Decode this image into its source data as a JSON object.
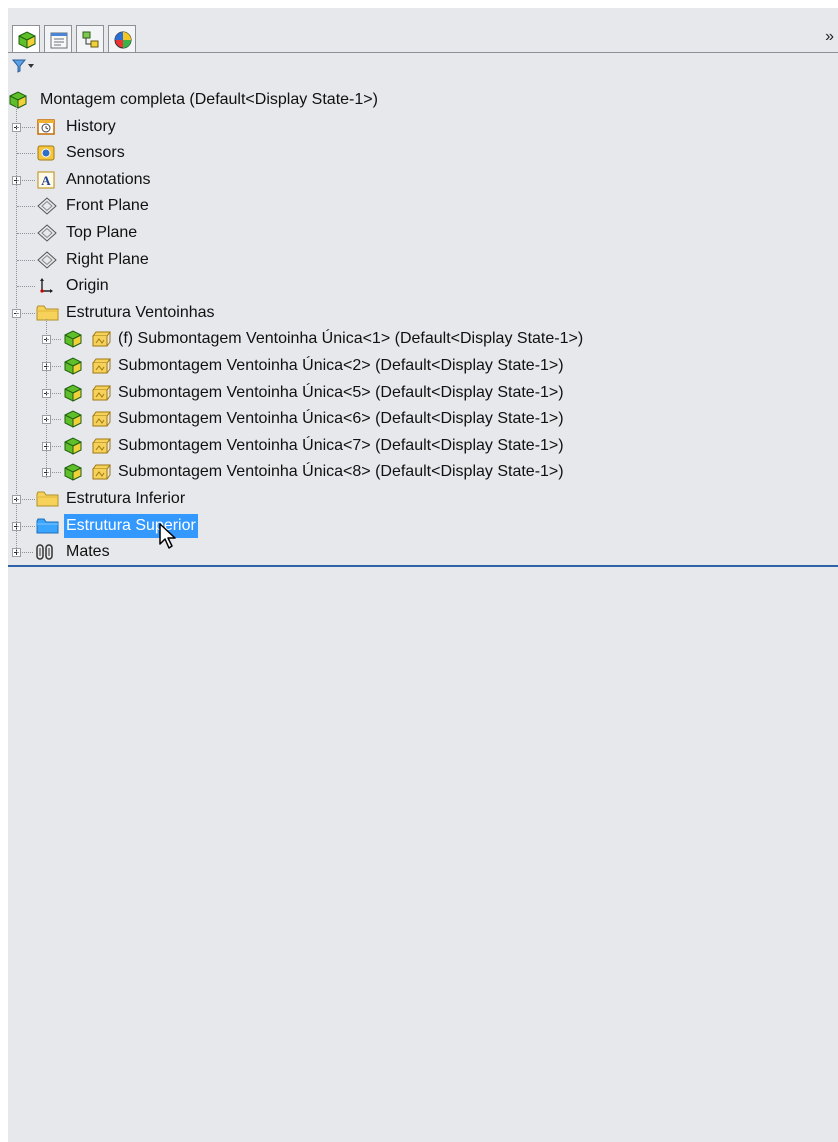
{
  "panel": {
    "tabs": [
      {
        "icon": "feature-manager-icon",
        "active": true
      },
      {
        "icon": "property-manager-icon",
        "active": false
      },
      {
        "icon": "configuration-manager-icon",
        "active": false
      },
      {
        "icon": "display-manager-icon",
        "active": false
      }
    ],
    "more_label": "»",
    "filter_icon": "filter-icon"
  },
  "tree": {
    "root": "Montagem completa  (Default<Display State-1>)",
    "items": [
      {
        "label": "History",
        "icon": "history-icon"
      },
      {
        "label": "Sensors",
        "icon": "sensors-icon"
      },
      {
        "label": "Annotations",
        "icon": "annotations-icon"
      },
      {
        "label": "Front Plane",
        "icon": "plane-icon"
      },
      {
        "label": "Top Plane",
        "icon": "plane-icon"
      },
      {
        "label": "Right Plane",
        "icon": "plane-icon"
      },
      {
        "label": "Origin",
        "icon": "origin-icon"
      },
      {
        "label": "Estrutura Ventoinhas",
        "icon": "folder-icon"
      }
    ],
    "subassemblies": [
      {
        "label": "(f) Submontagem Ventoinha Única<1> (Default<Display State-1>)"
      },
      {
        "label": "Submontagem Ventoinha Única<2> (Default<Display State-1>)"
      },
      {
        "label": "Submontagem Ventoinha Única<5> (Default<Display State-1>)"
      },
      {
        "label": "Submontagem Ventoinha Única<6> (Default<Display State-1>)"
      },
      {
        "label": "Submontagem Ventoinha Única<7> (Default<Display State-1>)"
      },
      {
        "label": "Submontagem Ventoinha Única<8> (Default<Display State-1>)"
      }
    ],
    "folders_after": [
      {
        "label": "Estrutura Inferior",
        "selected": false
      },
      {
        "label": "Estrutura Superior",
        "selected": true
      }
    ],
    "mates": {
      "label": "Mates",
      "icon": "mates-icon"
    }
  },
  "colors": {
    "panel_bg": "#e6e8ec",
    "selection": "#3399ff",
    "separator": "#2f62a8",
    "folder": "#f6d25a",
    "folder_selected": "#3aa5ff"
  }
}
